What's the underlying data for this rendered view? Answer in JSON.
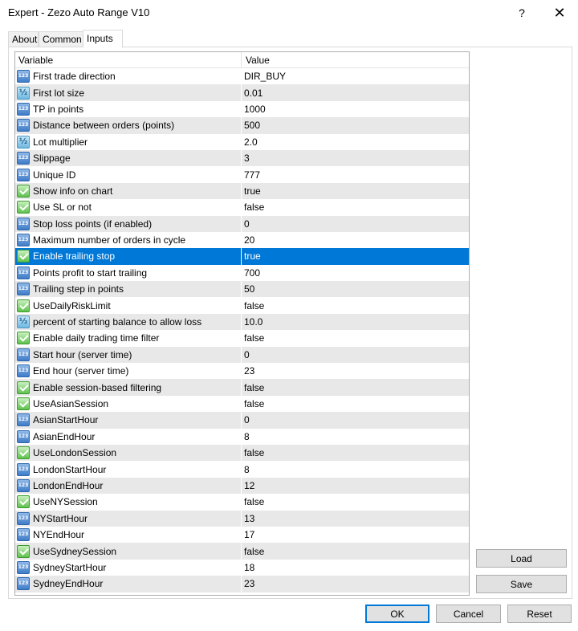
{
  "window": {
    "title": "Expert - Zezo Auto Range V10",
    "help_label": "?",
    "close_label": "✕"
  },
  "tabs": [
    {
      "label": "About"
    },
    {
      "label": "Common"
    },
    {
      "label": "Inputs"
    }
  ],
  "active_tab": "Inputs",
  "grid": {
    "header_variable": "Variable",
    "header_value": "Value",
    "rows": [
      {
        "icon": "int",
        "variable": "First trade direction",
        "value": "DIR_BUY"
      },
      {
        "icon": "dbl",
        "variable": "First lot size",
        "value": "0.01"
      },
      {
        "icon": "int",
        "variable": "TP in points",
        "value": "1000"
      },
      {
        "icon": "int",
        "variable": "Distance between orders (points)",
        "value": "500"
      },
      {
        "icon": "dbl",
        "variable": "Lot multiplier",
        "value": "2.0"
      },
      {
        "icon": "int",
        "variable": "Slippage",
        "value": "3"
      },
      {
        "icon": "int",
        "variable": "Unique ID",
        "value": "777"
      },
      {
        "icon": "bool",
        "variable": "Show info on chart",
        "value": "true"
      },
      {
        "icon": "bool",
        "variable": "Use SL or not",
        "value": "false"
      },
      {
        "icon": "int",
        "variable": "Stop loss points (if enabled)",
        "value": "0"
      },
      {
        "icon": "int",
        "variable": "Maximum number of orders in cycle",
        "value": "20"
      },
      {
        "icon": "bool",
        "variable": "Enable trailing stop",
        "value": "true",
        "selected": true
      },
      {
        "icon": "int",
        "variable": "Points profit to start trailing",
        "value": "700"
      },
      {
        "icon": "int",
        "variable": "Trailing step in points",
        "value": "50"
      },
      {
        "icon": "bool",
        "variable": "UseDailyRiskLimit",
        "value": "false"
      },
      {
        "icon": "dbl",
        "variable": "percent of starting balance to allow loss",
        "value": "10.0"
      },
      {
        "icon": "bool",
        "variable": "Enable daily trading time filter",
        "value": "false"
      },
      {
        "icon": "int",
        "variable": "Start hour (server time)",
        "value": "0"
      },
      {
        "icon": "int",
        "variable": "End hour (server time)",
        "value": "23"
      },
      {
        "icon": "bool",
        "variable": "Enable session-based filtering",
        "value": "false"
      },
      {
        "icon": "bool",
        "variable": "UseAsianSession",
        "value": "false"
      },
      {
        "icon": "int",
        "variable": "AsianStartHour",
        "value": "0"
      },
      {
        "icon": "int",
        "variable": "AsianEndHour",
        "value": "8"
      },
      {
        "icon": "bool",
        "variable": "UseLondonSession",
        "value": "false"
      },
      {
        "icon": "int",
        "variable": "LondonStartHour",
        "value": "8"
      },
      {
        "icon": "int",
        "variable": "LondonEndHour",
        "value": "12"
      },
      {
        "icon": "bool",
        "variable": "UseNYSession",
        "value": "false"
      },
      {
        "icon": "int",
        "variable": "NYStartHour",
        "value": "13"
      },
      {
        "icon": "int",
        "variable": "NYEndHour",
        "value": "17"
      },
      {
        "icon": "bool",
        "variable": "UseSydneySession",
        "value": "false"
      },
      {
        "icon": "int",
        "variable": "SydneyStartHour",
        "value": "18"
      },
      {
        "icon": "int",
        "variable": "SydneyEndHour",
        "value": "23"
      }
    ]
  },
  "buttons": {
    "load": "Load",
    "save": "Save",
    "ok": "OK",
    "cancel": "Cancel",
    "reset": "Reset"
  },
  "colors": {
    "selection": "#0078d7",
    "alt_row": "#e8e8e8",
    "button_face": "#e1e1e1"
  }
}
